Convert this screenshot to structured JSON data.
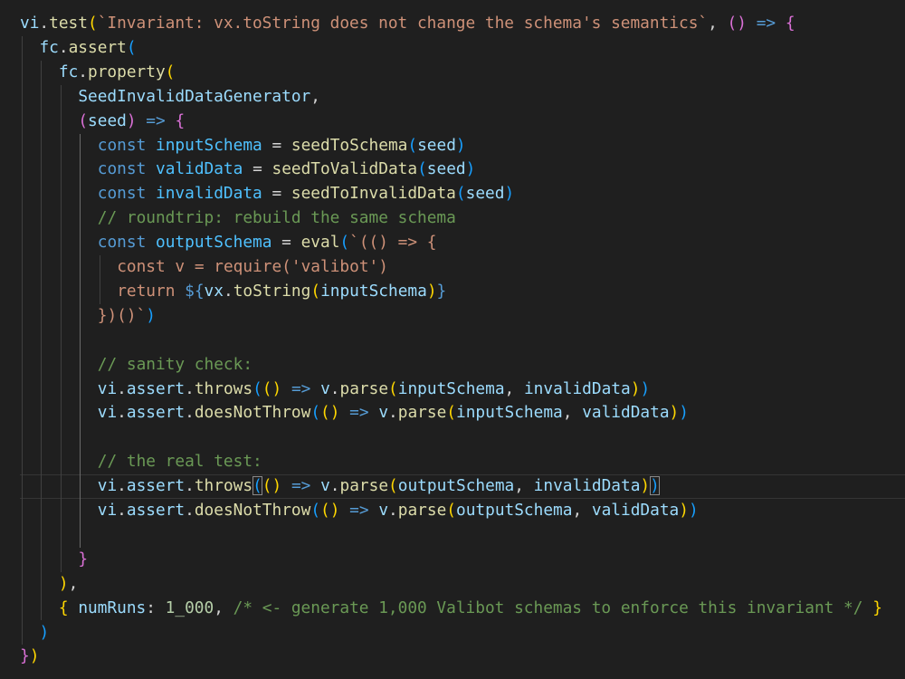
{
  "theme": {
    "background": "#1f1f1f",
    "colors": {
      "func": "#dcdcaa",
      "var": "#9cdcfe",
      "const": "#4fc1ff",
      "kw": "#569cd6",
      "str": "#ce9178",
      "comment": "#6a9955",
      "num": "#b5cea8",
      "br1": "#ffd700",
      "br2": "#da70d6",
      "br3": "#179fff",
      "punc": "#d4d4d4",
      "tmpl": "#569cd6"
    }
  },
  "editor": {
    "lines": [
      {
        "indent": 0,
        "tokens": [
          {
            "t": "vi",
            "c": "var"
          },
          {
            "t": ".",
            "c": "punc"
          },
          {
            "t": "test",
            "c": "func"
          },
          {
            "t": "(",
            "c": "br1"
          },
          {
            "t": "`Invariant: vx.toString does not change the schema's semantics`",
            "c": "str"
          },
          {
            "t": ", ",
            "c": "punc"
          },
          {
            "t": "()",
            "c": "br2"
          },
          {
            "t": " ",
            "c": "punc"
          },
          {
            "t": "=>",
            "c": "kw"
          },
          {
            "t": " ",
            "c": "punc"
          },
          {
            "t": "{",
            "c": "br2"
          }
        ]
      },
      {
        "indent": 1,
        "tokens": [
          {
            "t": "fc",
            "c": "var"
          },
          {
            "t": ".",
            "c": "punc"
          },
          {
            "t": "assert",
            "c": "func"
          },
          {
            "t": "(",
            "c": "br3"
          }
        ]
      },
      {
        "indent": 2,
        "tokens": [
          {
            "t": "fc",
            "c": "var"
          },
          {
            "t": ".",
            "c": "punc"
          },
          {
            "t": "property",
            "c": "func"
          },
          {
            "t": "(",
            "c": "br1"
          }
        ]
      },
      {
        "indent": 3,
        "tokens": [
          {
            "t": "SeedInvalidDataGenerator",
            "c": "var"
          },
          {
            "t": ",",
            "c": "punc"
          }
        ]
      },
      {
        "indent": 3,
        "tokens": [
          {
            "t": "(",
            "c": "br2"
          },
          {
            "t": "seed",
            "c": "var"
          },
          {
            "t": ")",
            "c": "br2"
          },
          {
            "t": " ",
            "c": "punc"
          },
          {
            "t": "=>",
            "c": "kw"
          },
          {
            "t": " ",
            "c": "punc"
          },
          {
            "t": "{",
            "c": "br2"
          }
        ]
      },
      {
        "indent": 4,
        "tokens": [
          {
            "t": "const",
            "c": "kw"
          },
          {
            "t": " ",
            "c": "punc"
          },
          {
            "t": "inputSchema",
            "c": "const"
          },
          {
            "t": " = ",
            "c": "punc"
          },
          {
            "t": "seedToSchema",
            "c": "func"
          },
          {
            "t": "(",
            "c": "br3"
          },
          {
            "t": "seed",
            "c": "var"
          },
          {
            "t": ")",
            "c": "br3"
          }
        ]
      },
      {
        "indent": 4,
        "tokens": [
          {
            "t": "const",
            "c": "kw"
          },
          {
            "t": " ",
            "c": "punc"
          },
          {
            "t": "validData",
            "c": "const"
          },
          {
            "t": " = ",
            "c": "punc"
          },
          {
            "t": "seedToValidData",
            "c": "func"
          },
          {
            "t": "(",
            "c": "br3"
          },
          {
            "t": "seed",
            "c": "var"
          },
          {
            "t": ")",
            "c": "br3"
          }
        ]
      },
      {
        "indent": 4,
        "tokens": [
          {
            "t": "const",
            "c": "kw"
          },
          {
            "t": " ",
            "c": "punc"
          },
          {
            "t": "invalidData",
            "c": "const"
          },
          {
            "t": " = ",
            "c": "punc"
          },
          {
            "t": "seedToInvalidData",
            "c": "func"
          },
          {
            "t": "(",
            "c": "br3"
          },
          {
            "t": "seed",
            "c": "var"
          },
          {
            "t": ")",
            "c": "br3"
          }
        ]
      },
      {
        "indent": 4,
        "tokens": [
          {
            "t": "// roundtrip: rebuild the same schema",
            "c": "comment"
          }
        ]
      },
      {
        "indent": 4,
        "tokens": [
          {
            "t": "const",
            "c": "kw"
          },
          {
            "t": " ",
            "c": "punc"
          },
          {
            "t": "outputSchema",
            "c": "const"
          },
          {
            "t": " = ",
            "c": "punc"
          },
          {
            "t": "eval",
            "c": "func"
          },
          {
            "t": "(",
            "c": "br3"
          },
          {
            "t": "`(() => {",
            "c": "str"
          }
        ]
      },
      {
        "indent": 5,
        "tokens": [
          {
            "t": "const v = require('valibot')",
            "c": "str"
          }
        ]
      },
      {
        "indent": 5,
        "tokens": [
          {
            "t": "return ",
            "c": "str"
          },
          {
            "t": "${",
            "c": "tmpl"
          },
          {
            "t": "vx",
            "c": "var"
          },
          {
            "t": ".",
            "c": "punc"
          },
          {
            "t": "toString",
            "c": "func"
          },
          {
            "t": "(",
            "c": "br1"
          },
          {
            "t": "inputSchema",
            "c": "var"
          },
          {
            "t": ")",
            "c": "br1"
          },
          {
            "t": "}",
            "c": "tmpl"
          }
        ]
      },
      {
        "indent": 4,
        "tokens": [
          {
            "t": "})()`",
            "c": "str"
          },
          {
            "t": ")",
            "c": "br3"
          }
        ]
      },
      {
        "indent": 4,
        "tokens": []
      },
      {
        "indent": 4,
        "tokens": [
          {
            "t": "// sanity check:",
            "c": "comment"
          }
        ]
      },
      {
        "indent": 4,
        "tokens": [
          {
            "t": "vi",
            "c": "var"
          },
          {
            "t": ".",
            "c": "punc"
          },
          {
            "t": "assert",
            "c": "var"
          },
          {
            "t": ".",
            "c": "punc"
          },
          {
            "t": "throws",
            "c": "func"
          },
          {
            "t": "(",
            "c": "br3"
          },
          {
            "t": "()",
            "c": "br1"
          },
          {
            "t": " ",
            "c": "punc"
          },
          {
            "t": "=>",
            "c": "kw"
          },
          {
            "t": " ",
            "c": "punc"
          },
          {
            "t": "v",
            "c": "var"
          },
          {
            "t": ".",
            "c": "punc"
          },
          {
            "t": "parse",
            "c": "func"
          },
          {
            "t": "(",
            "c": "br1"
          },
          {
            "t": "inputSchema",
            "c": "var"
          },
          {
            "t": ", ",
            "c": "punc"
          },
          {
            "t": "invalidData",
            "c": "var"
          },
          {
            "t": ")",
            "c": "br1"
          },
          {
            "t": ")",
            "c": "br3"
          }
        ]
      },
      {
        "indent": 4,
        "tokens": [
          {
            "t": "vi",
            "c": "var"
          },
          {
            "t": ".",
            "c": "punc"
          },
          {
            "t": "assert",
            "c": "var"
          },
          {
            "t": ".",
            "c": "punc"
          },
          {
            "t": "doesNotThrow",
            "c": "func"
          },
          {
            "t": "(",
            "c": "br3"
          },
          {
            "t": "()",
            "c": "br1"
          },
          {
            "t": " ",
            "c": "punc"
          },
          {
            "t": "=>",
            "c": "kw"
          },
          {
            "t": " ",
            "c": "punc"
          },
          {
            "t": "v",
            "c": "var"
          },
          {
            "t": ".",
            "c": "punc"
          },
          {
            "t": "parse",
            "c": "func"
          },
          {
            "t": "(",
            "c": "br1"
          },
          {
            "t": "inputSchema",
            "c": "var"
          },
          {
            "t": ", ",
            "c": "punc"
          },
          {
            "t": "validData",
            "c": "var"
          },
          {
            "t": ")",
            "c": "br1"
          },
          {
            "t": ")",
            "c": "br3"
          }
        ]
      },
      {
        "indent": 4,
        "tokens": []
      },
      {
        "indent": 4,
        "tokens": [
          {
            "t": "// the real test:",
            "c": "comment"
          }
        ]
      },
      {
        "indent": 4,
        "cursor": true,
        "tokens": [
          {
            "t": "vi",
            "c": "var"
          },
          {
            "t": ".",
            "c": "punc"
          },
          {
            "t": "assert",
            "c": "var"
          },
          {
            "t": ".",
            "c": "punc"
          },
          {
            "t": "throws",
            "c": "func"
          },
          {
            "t": "(",
            "c": "br3",
            "box": true
          },
          {
            "t": "()",
            "c": "br1"
          },
          {
            "t": " ",
            "c": "punc"
          },
          {
            "t": "=>",
            "c": "kw"
          },
          {
            "t": " ",
            "c": "punc"
          },
          {
            "t": "v",
            "c": "var"
          },
          {
            "t": ".",
            "c": "punc"
          },
          {
            "t": "parse",
            "c": "func"
          },
          {
            "t": "(",
            "c": "br1"
          },
          {
            "t": "outputSchema",
            "c": "var"
          },
          {
            "t": ", ",
            "c": "punc"
          },
          {
            "t": "invalidData",
            "c": "var"
          },
          {
            "t": ")",
            "c": "br1"
          },
          {
            "t": ")",
            "c": "br3",
            "box": true
          }
        ]
      },
      {
        "indent": 4,
        "tokens": [
          {
            "t": "vi",
            "c": "var"
          },
          {
            "t": ".",
            "c": "punc"
          },
          {
            "t": "assert",
            "c": "var"
          },
          {
            "t": ".",
            "c": "punc"
          },
          {
            "t": "doesNotThrow",
            "c": "func"
          },
          {
            "t": "(",
            "c": "br3"
          },
          {
            "t": "()",
            "c": "br1"
          },
          {
            "t": " ",
            "c": "punc"
          },
          {
            "t": "=>",
            "c": "kw"
          },
          {
            "t": " ",
            "c": "punc"
          },
          {
            "t": "v",
            "c": "var"
          },
          {
            "t": ".",
            "c": "punc"
          },
          {
            "t": "parse",
            "c": "func"
          },
          {
            "t": "(",
            "c": "br1"
          },
          {
            "t": "outputSchema",
            "c": "var"
          },
          {
            "t": ", ",
            "c": "punc"
          },
          {
            "t": "validData",
            "c": "var"
          },
          {
            "t": ")",
            "c": "br1"
          },
          {
            "t": ")",
            "c": "br3"
          }
        ]
      },
      {
        "indent": 4,
        "tokens": []
      },
      {
        "indent": 3,
        "tokens": [
          {
            "t": "}",
            "c": "br2"
          }
        ]
      },
      {
        "indent": 2,
        "tokens": [
          {
            "t": ")",
            "c": "br1"
          },
          {
            "t": ",",
            "c": "punc"
          }
        ]
      },
      {
        "indent": 2,
        "tokens": [
          {
            "t": "{",
            "c": "br1"
          },
          {
            "t": " ",
            "c": "punc"
          },
          {
            "t": "numRuns",
            "c": "var"
          },
          {
            "t": ": ",
            "c": "punc"
          },
          {
            "t": "1_000",
            "c": "num"
          },
          {
            "t": ", ",
            "c": "punc"
          },
          {
            "t": "/* <- generate 1,000 Valibot schemas to enforce this invariant */",
            "c": "comment"
          },
          {
            "t": " ",
            "c": "punc"
          },
          {
            "t": "}",
            "c": "br1"
          }
        ]
      },
      {
        "indent": 1,
        "tokens": [
          {
            "t": ")",
            "c": "br3"
          }
        ]
      },
      {
        "indent": 0,
        "tokens": [
          {
            "t": "}",
            "c": "br2"
          },
          {
            "t": ")",
            "c": "br1"
          }
        ]
      }
    ]
  }
}
